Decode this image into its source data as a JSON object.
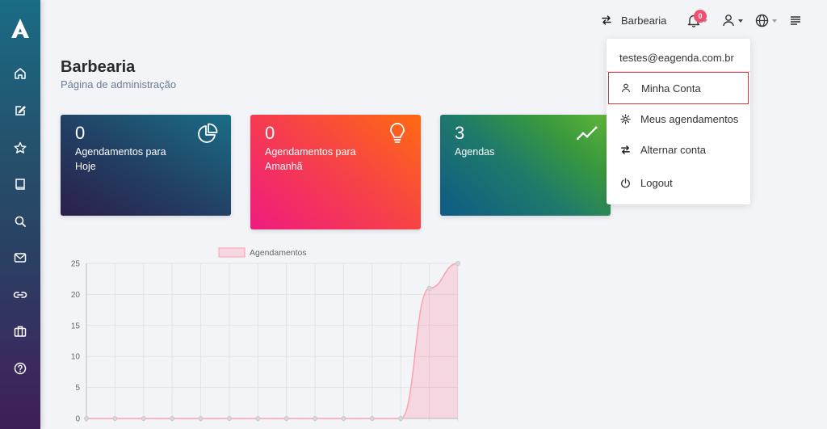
{
  "topbar": {
    "account_name": "Barbearia",
    "notification_count": "0"
  },
  "header": {
    "title": "Barbearia",
    "subtitle": "Página de administração"
  },
  "cards": [
    {
      "value": "0",
      "label": "Agendamentos para Hoje",
      "icon": "pie-chart-icon"
    },
    {
      "value": "0",
      "label": "Agendamentos para Amanhã",
      "icon": "lightbulb-icon"
    },
    {
      "value": "3",
      "label": "Agendas",
      "icon": "trending-up-icon"
    }
  ],
  "dropdown": {
    "email": "testes@eagenda.com.br",
    "items": [
      {
        "label": "Minha Conta",
        "icon": "user-icon"
      },
      {
        "label": "Meus agendamentos",
        "icon": "gear-icon"
      },
      {
        "label": "Alternar conta",
        "icon": "switch-icon"
      },
      {
        "label": "Logout",
        "icon": "power-icon"
      }
    ]
  },
  "sidebar": {
    "items": [
      "home-icon",
      "edit-icon",
      "star-icon",
      "book-icon",
      "search-icon",
      "mail-icon",
      "link-icon",
      "briefcase-icon",
      "help-icon"
    ]
  },
  "colors": {
    "accent": "#f0506e",
    "highlight_border": "#d9363e",
    "chart_fill": "rgba(255,99,132,0.2)",
    "chart_line": "#ff9fb1"
  },
  "chart_data": {
    "type": "area",
    "series": [
      {
        "name": "Agendamentos",
        "values": [
          0,
          0,
          0,
          0,
          0,
          0,
          0,
          0,
          0,
          0,
          0,
          0,
          21,
          25
        ]
      }
    ],
    "ylim": [
      0,
      25
    ],
    "yticks": [
      0,
      5,
      10,
      15,
      20,
      25
    ],
    "legend": "top",
    "grid": true
  }
}
